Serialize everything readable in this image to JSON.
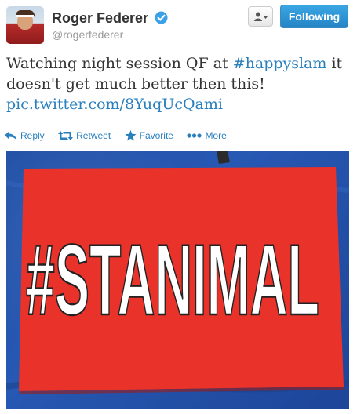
{
  "profile": {
    "name": "Roger Federer",
    "handle": "@rogerfederer",
    "verified_icon": "verified-badge-icon"
  },
  "header_actions": {
    "user_menu_icon": "person-icon",
    "follow_label": "Following"
  },
  "tweet": {
    "text_before": "Watching night session QF at ",
    "hashtag": "#happyslam",
    "text_after": " it doesn't get much better then this!",
    "link": "pic.twitter.com/8YuqUcQami"
  },
  "actions": [
    {
      "icon": "reply-icon",
      "label": "Reply"
    },
    {
      "icon": "retweet-icon",
      "label": "Retweet"
    },
    {
      "icon": "star-icon",
      "label": "Favorite"
    },
    {
      "icon": "more-dots-icon",
      "label": "More"
    }
  ],
  "photo": {
    "sign_text": "#STANIMAL"
  },
  "colors": {
    "link": "#2a7fbd",
    "follow_button": "#2483c5",
    "sign_red": "#e8322a",
    "background_blue": "#2556ad"
  }
}
